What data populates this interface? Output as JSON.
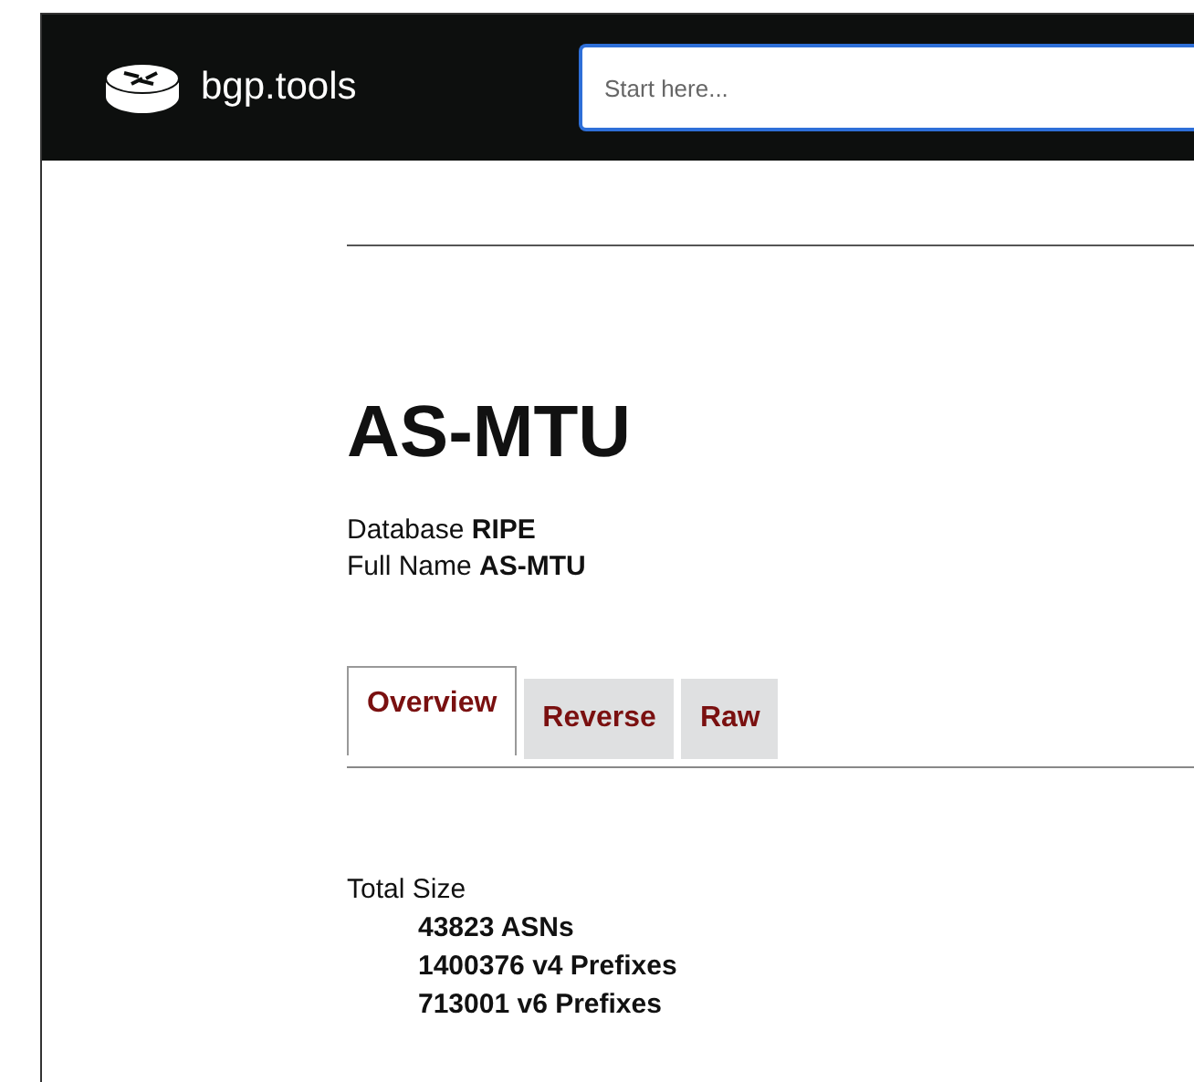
{
  "header": {
    "site_name": "bgp.tools",
    "search": {
      "placeholder": "Start here..."
    }
  },
  "title": "AS-MTU",
  "fields": [
    {
      "label": "Database",
      "value": "RIPE"
    },
    {
      "label": "Full Name",
      "value": "AS-MTU"
    }
  ],
  "tabs": [
    {
      "label": "Overview",
      "selected": true
    },
    {
      "label": "Reverse",
      "selected": false
    },
    {
      "label": "Raw",
      "selected": false
    }
  ],
  "total_size": {
    "label": "Total Size",
    "items": [
      "43823 ASNs",
      "1400376 v4 Prefixes",
      "713001 v6 Prefixes"
    ]
  }
}
